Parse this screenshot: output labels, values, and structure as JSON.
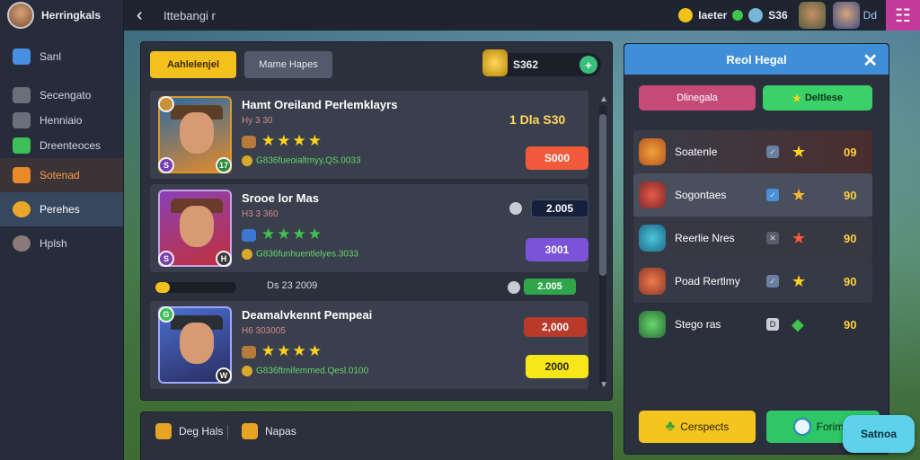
{
  "profile": {
    "name": "Herringkals"
  },
  "sidebar": {
    "items": [
      {
        "label": "Sanl",
        "color": "#4a90e2"
      },
      {
        "label": "Secengato",
        "color": "#6b6f7a"
      },
      {
        "label": "Henniaio",
        "color": "#6b6f7a"
      },
      {
        "label": "Dreenteoces",
        "color": "#3fbf5a"
      },
      {
        "label": "Sotenad",
        "color": "#e98a2a"
      },
      {
        "label": "Perehes",
        "color": "#e9a62a"
      },
      {
        "label": "Hplsh",
        "color": "#8a7a7a"
      }
    ]
  },
  "topbar": {
    "breadcrumb": "Ittebangi r",
    "res1": "Iaeter",
    "res2": "S36",
    "square_label": "Dd"
  },
  "main": {
    "tab_primary": "Aahlelenjel",
    "tab_secondary": "Mame  Hapes",
    "gold": "S362",
    "cards": [
      {
        "title": "Hamt Oreiland Perlemklayrs",
        "sub": "Hy 3 30",
        "line": "G836fueoialtmyy,QS.0033",
        "badge_left": "S",
        "badge_right": "17",
        "level": "1   Dla  S30",
        "price": "S000",
        "price_color": "#f15a3a"
      },
      {
        "title": "Srooe lor Mas",
        "sub": "H3 3 360",
        "line": "G836funhuentlelyes.3033",
        "badge_left": "S",
        "badge_right": "H",
        "pill": "2.005",
        "price": "3001",
        "price_color": "#7b53d8"
      },
      {
        "title": "Deamalvkennt Pempeai",
        "sub": "H6 303005",
        "line": "G836ftmifemmed.Qesl.0100",
        "badge_left": "G",
        "badge_right": "W",
        "pill_top": "2,000",
        "price": "2000",
        "price_color": "#f6e61a"
      }
    ],
    "progress": {
      "text": "Ds  23 2009",
      "pill": "2.005",
      "fill": 0.18
    }
  },
  "bottom_tabs": [
    {
      "label": "Deg Hals"
    },
    {
      "label": "Napas"
    }
  ],
  "right": {
    "title": "Reol Hegal",
    "tab1": "Dlinegala",
    "tab2": "Deltlese",
    "rows": [
      {
        "name": "Soatenle",
        "value": "09",
        "star": "★",
        "star_color": "#ffd21f"
      },
      {
        "name": "Sogontaes",
        "value": "90",
        "star": "★",
        "star_color": "#ffb732"
      },
      {
        "name": "Reerlie Nres",
        "value": "90",
        "star": "★",
        "star_color": "#ff5a3a"
      },
      {
        "name": "Poad Rertlmy",
        "value": "90",
        "star": "★",
        "star_color": "#ffd21f"
      },
      {
        "name": "Stego ras",
        "value": "90",
        "star": "◆",
        "star_color": "#3fc34c",
        "chk": "D"
      }
    ],
    "btn_left": "Cerspects",
    "btn_right": "Forimm"
  },
  "float_button": "Satnoa"
}
